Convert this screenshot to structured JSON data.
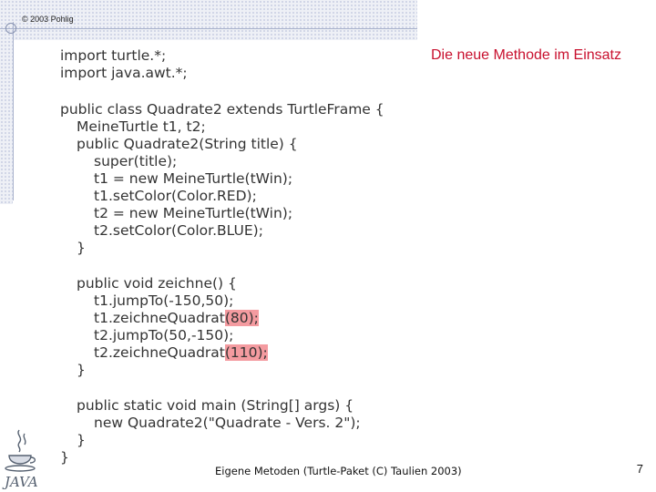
{
  "header": {
    "copyright": "© 2003 Pohlig"
  },
  "slide": {
    "title": "Die neue Methode im Einsatz"
  },
  "code": {
    "imports": [
      "import turtle.*;",
      "import java.awt.*;"
    ],
    "class_decl": "public class Quadrate2 extends TurtleFrame {",
    "field_decl": "MeineTurtle t1, t2;",
    "ctor": [
      "public Quadrate2(String title) {",
      "super(title);",
      "t1 = new MeineTurtle(tWin);",
      "t1.setColor(Color.RED);",
      "t2 = new MeineTurtle(tWin);",
      "t2.setColor(Color.BLUE);",
      "}"
    ],
    "zeichne": {
      "head": "public void zeichne() {",
      "l1": "t1.jumpTo(-150,50);",
      "l2_pre": "t1.zeichneQuadrat",
      "l2_hl": "(80);",
      "l3": "t2.jumpTo(50,-150);",
      "l4_pre": "t2.zeichneQuadrat",
      "l4_hl": "(110);",
      "close": "}"
    },
    "main": [
      "public static void main (String[] args) {",
      "new Quadrate2(\"Quadrate - Vers. 2\");",
      "}"
    ],
    "class_close": "}"
  },
  "footer": {
    "text": "Eigene Metoden (Turtle-Paket (C) Taulien 2003)",
    "page": "7"
  },
  "logo": {
    "text": "JAVA",
    "icon": "java-coffee-cup-icon"
  }
}
